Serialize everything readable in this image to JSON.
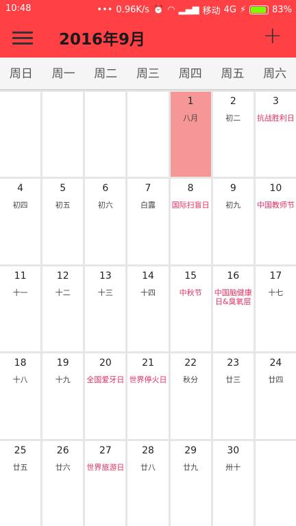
{
  "status_bar": {
    "time": "10:48",
    "speed": "0.96K/s",
    "carrier": "移动",
    "network": "4G",
    "battery": "83%"
  },
  "app_bar": {
    "title": "2016年9月"
  },
  "weekdays": [
    "周日",
    "周一",
    "周二",
    "周三",
    "周四",
    "周五",
    "周六"
  ],
  "colors": {
    "app_bar": "#ff4146",
    "selected_day": "#f49796",
    "holiday_text": "#e0305f"
  },
  "days": [
    {
      "num": "",
      "sub": ""
    },
    {
      "num": "",
      "sub": ""
    },
    {
      "num": "",
      "sub": ""
    },
    {
      "num": "",
      "sub": ""
    },
    {
      "num": "1",
      "sub": "八月",
      "selected": true
    },
    {
      "num": "2",
      "sub": "初二"
    },
    {
      "num": "3",
      "sub": "抗战胜利日",
      "holiday": true
    },
    {
      "num": "4",
      "sub": "初四"
    },
    {
      "num": "5",
      "sub": "初五"
    },
    {
      "num": "6",
      "sub": "初六"
    },
    {
      "num": "7",
      "sub": "白露"
    },
    {
      "num": "8",
      "sub": "国际扫盲日",
      "holiday": true
    },
    {
      "num": "9",
      "sub": "初九"
    },
    {
      "num": "10",
      "sub": "中国教师节",
      "holiday": true
    },
    {
      "num": "11",
      "sub": "十一"
    },
    {
      "num": "12",
      "sub": "十二"
    },
    {
      "num": "13",
      "sub": "十三"
    },
    {
      "num": "14",
      "sub": "十四"
    },
    {
      "num": "15",
      "sub": "中秋节",
      "holiday": true
    },
    {
      "num": "16",
      "sub": "中国脑健康日&臭氧层",
      "holiday": true
    },
    {
      "num": "17",
      "sub": "十七"
    },
    {
      "num": "18",
      "sub": "十八"
    },
    {
      "num": "19",
      "sub": "十九"
    },
    {
      "num": "20",
      "sub": "全国爱牙日",
      "holiday": true
    },
    {
      "num": "21",
      "sub": "世界停火日",
      "holiday": true
    },
    {
      "num": "22",
      "sub": "秋分"
    },
    {
      "num": "23",
      "sub": "廿三"
    },
    {
      "num": "24",
      "sub": "廿四"
    },
    {
      "num": "25",
      "sub": "廿五"
    },
    {
      "num": "26",
      "sub": "廿六"
    },
    {
      "num": "27",
      "sub": "世界旅游日",
      "holiday": true
    },
    {
      "num": "28",
      "sub": "廿八"
    },
    {
      "num": "29",
      "sub": "廿九"
    },
    {
      "num": "30",
      "sub": "卅十"
    },
    {
      "num": "",
      "sub": ""
    }
  ]
}
